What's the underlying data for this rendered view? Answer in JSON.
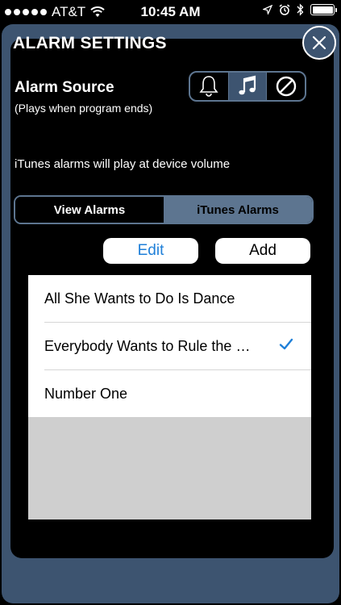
{
  "status_bar": {
    "signal_dots_filled": 5,
    "carrier": "AT&T",
    "time": "10:45 AM",
    "icons": [
      "wifi-icon",
      "location-arrow-icon",
      "alarm-clock-icon",
      "bluetooth-icon",
      "battery-icon"
    ],
    "battery_level": 1.0
  },
  "header": {
    "title": "ALARM SETTINGS",
    "close_icon": "close-icon"
  },
  "alarm_source": {
    "label": "Alarm Source",
    "subtitle": "(Plays when program ends)",
    "options": [
      {
        "icon": "bell-icon",
        "selected": false
      },
      {
        "icon": "music-note-icon",
        "selected": true
      },
      {
        "icon": "no-sound-icon",
        "selected": false
      }
    ]
  },
  "volume_note": "iTunes alarms will play at device volume",
  "tabs": [
    {
      "label": "View Alarms",
      "active": true
    },
    {
      "label": "iTunes Alarms",
      "active": false
    }
  ],
  "buttons": {
    "edit": "Edit",
    "add": "Add"
  },
  "alarm_list": [
    {
      "title": "All She Wants to Do Is Dance",
      "checked": false
    },
    {
      "title": "Everybody Wants to Rule the World",
      "checked": true
    },
    {
      "title": "Number One",
      "checked": false
    }
  ],
  "colors": {
    "panel": "#3d5470",
    "border": "#5d7590",
    "accent": "#1e7fd8",
    "list_empty": "#cfcfcf"
  }
}
